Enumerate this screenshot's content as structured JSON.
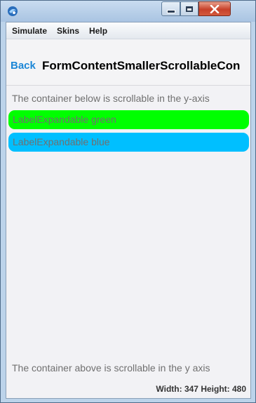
{
  "window": {
    "icon": "app-icon"
  },
  "menubar": {
    "items": [
      "Simulate",
      "Skins",
      "Help"
    ]
  },
  "toolbar": {
    "back_label": "Back",
    "title": "FormContentSmallerScrollableCon"
  },
  "content": {
    "info_top": "The container below is scrollable in the y-axis",
    "labels": [
      {
        "text": "LabelExpandable green",
        "color": "#00ff00"
      },
      {
        "text": "LabelExpandable blue",
        "color": "#00bfff"
      }
    ],
    "info_bottom": "The container above is scrollable in the y axis"
  },
  "statusbar": {
    "text": "Width: 347  Height: 480"
  },
  "colors": {
    "accent": "#1b86d6",
    "close_button": "#c7412a"
  }
}
